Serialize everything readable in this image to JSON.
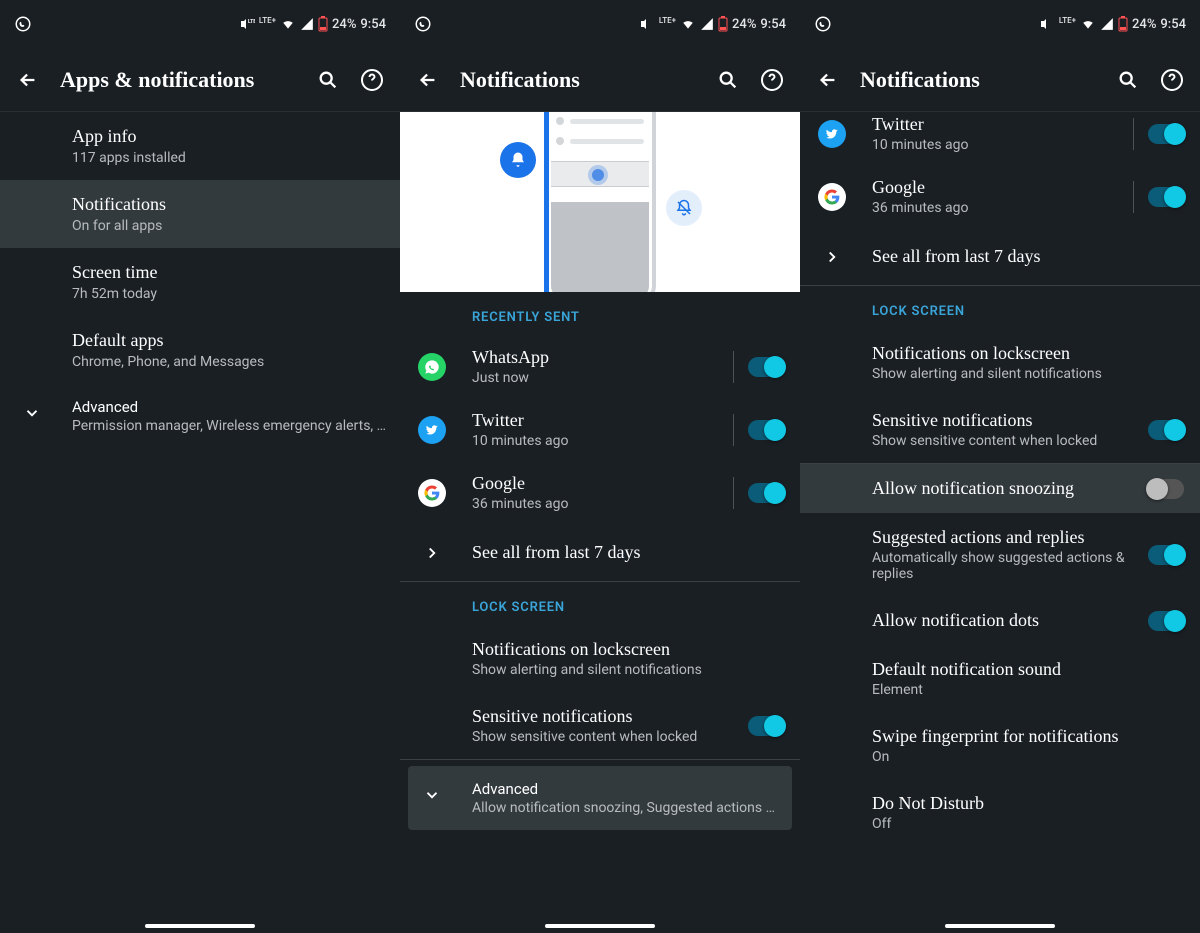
{
  "status": {
    "battery": "24%",
    "time": "9:54",
    "lte": "LTE+"
  },
  "screens": [
    {
      "title": "Apps & notifications",
      "items": [
        {
          "primary": "App info",
          "secondary": "117 apps installed"
        },
        {
          "primary": "Notifications",
          "secondary": "On for all apps"
        },
        {
          "primary": "Screen time",
          "secondary": "7h 52m today"
        },
        {
          "primary": "Default apps",
          "secondary": "Chrome, Phone, and Messages"
        }
      ],
      "advanced": {
        "primary": "Advanced",
        "secondary": "Permission manager, Wireless emergency alerts, Sp.."
      }
    },
    {
      "title": "Notifications",
      "recentlySentHeader": "Recently Sent",
      "apps": [
        {
          "name": "WhatsApp",
          "time": "Just now"
        },
        {
          "name": "Twitter",
          "time": "10 minutes ago"
        },
        {
          "name": "Google",
          "time": "36 minutes ago"
        }
      ],
      "seeAll": "See all from last 7 days",
      "lockScreenHeader": "Lock Screen",
      "lock": [
        {
          "primary": "Notifications on lockscreen",
          "secondary": "Show alerting and silent notifications"
        },
        {
          "primary": "Sensitive notifications",
          "secondary": "Show sensitive content when locked"
        }
      ],
      "advanced": {
        "primary": "Advanced",
        "secondary": "Allow notification snoozing, Suggested actions and.."
      }
    },
    {
      "title": "Notifications",
      "apps": [
        {
          "name": "Twitter",
          "time": "10 minutes ago"
        },
        {
          "name": "Google",
          "time": "36 minutes ago"
        }
      ],
      "seeAll": "See all from last 7 days",
      "lockScreenHeader": "Lock Screen",
      "lock": [
        {
          "primary": "Notifications on lockscreen",
          "secondary": "Show alerting and silent notifications"
        },
        {
          "primary": "Sensitive notifications",
          "secondary": "Show sensitive content when locked"
        }
      ],
      "settings": [
        {
          "primary": "Allow notification snoozing",
          "secondary": "",
          "toggle": "off"
        },
        {
          "primary": "Suggested actions and replies",
          "secondary": "Automatically show suggested actions & replies",
          "toggle": "on"
        },
        {
          "primary": "Allow notification dots",
          "secondary": "",
          "toggle": "on"
        },
        {
          "primary": "Default notification sound",
          "secondary": "Element"
        },
        {
          "primary": "Swipe fingerprint for notifications",
          "secondary": "On"
        },
        {
          "primary": "Do Not Disturb",
          "secondary": "Off"
        }
      ]
    }
  ]
}
